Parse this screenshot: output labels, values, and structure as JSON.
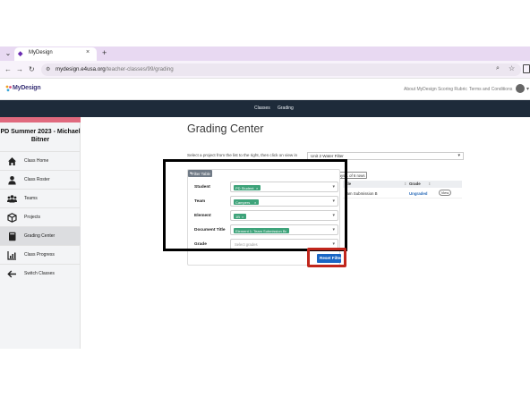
{
  "browser": {
    "tab_title": "MyDesign",
    "url_host": "mydesign.e4usa.org",
    "url_path": "/teacher-classes/99/grading",
    "new_tab_label": "+",
    "close_label": "×"
  },
  "header": {
    "logo_text": "MyDesign",
    "links": [
      "About MyDesign Scoring Rubric",
      "Terms and Conditions"
    ]
  },
  "topnav": {
    "items": [
      "Classes",
      "Grading"
    ]
  },
  "sidebar": {
    "course_title": "PD Summer 2023 - Michael Bitner",
    "items": [
      {
        "label": "Class Home",
        "icon": "home-icon"
      },
      {
        "label": "Class Roster",
        "icon": "person-icon"
      },
      {
        "label": "Teams",
        "icon": "group-icon"
      },
      {
        "label": "Projects",
        "icon": "cube-icon"
      },
      {
        "label": "Grading Center",
        "icon": "book-icon",
        "active": true
      },
      {
        "label": "Class Progress",
        "icon": "chart-icon"
      },
      {
        "label": "Switch Classes",
        "icon": "arrow-left-icon"
      }
    ]
  },
  "main": {
    "title": "Grading Center",
    "instructions": "Select a project from the list to the right, then click on view in",
    "project_select": "Unit 2 Water Filter",
    "table_filter_toggle": "Table filter displays 1 of 6 rows",
    "filter_tag": "Filter Table",
    "filters": [
      {
        "label": "Student",
        "chip": "PD Student"
      },
      {
        "label": "Team",
        "chip": "Campers"
      },
      {
        "label": "Element",
        "chip": "1B"
      },
      {
        "label": "Document Title",
        "chip": "Element 1: Team Submission B"
      },
      {
        "label": "Grade",
        "placeholder": "Select grades"
      }
    ],
    "reset_label": "Reset Filter",
    "results": {
      "columns": [
        "tle",
        "Grade"
      ],
      "rows": [
        {
          "title": "eam Submission B",
          "grade": "Ungraded",
          "action": "View"
        }
      ]
    }
  },
  "colors": {
    "accent_pink": "#e06a7e",
    "nav_dark": "#1e2b3a",
    "chip_green": "#3ea37a",
    "button_blue": "#1a66c4",
    "highlight_red": "#c0261c"
  }
}
